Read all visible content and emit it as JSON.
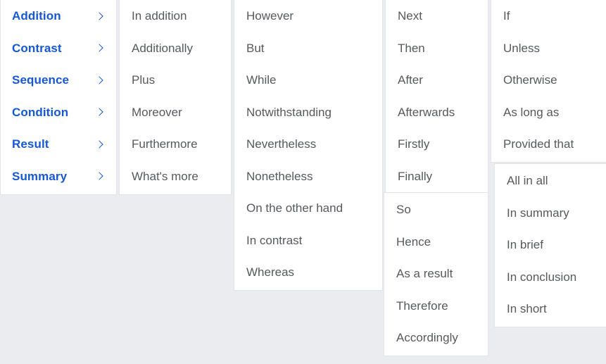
{
  "theme": {
    "background": "#ebecef",
    "panel_background": "#ffffff",
    "panel_border": "#e3e4e8",
    "accent_blue": "#1558d6",
    "leaf_text": "#56595d"
  },
  "menu": {
    "categories": {
      "panel_name": "categories-panel",
      "chevron_glyph": "chevron-right-icon",
      "items": [
        {
          "label": "Addition"
        },
        {
          "label": "Contrast"
        },
        {
          "label": "Sequence"
        },
        {
          "label": "Condition"
        },
        {
          "label": "Result"
        },
        {
          "label": "Summary"
        }
      ]
    },
    "addition": {
      "panel_name": "addition-panel",
      "items": [
        {
          "label": "In addition"
        },
        {
          "label": "Additionally"
        },
        {
          "label": "Plus"
        },
        {
          "label": "Moreover"
        },
        {
          "label": "Furthermore"
        },
        {
          "label": "What's more"
        }
      ]
    },
    "contrast": {
      "panel_name": "contrast-panel",
      "items": [
        {
          "label": "However"
        },
        {
          "label": "But"
        },
        {
          "label": "While"
        },
        {
          "label": "Notwithstanding"
        },
        {
          "label": "Nevertheless"
        },
        {
          "label": "Nonetheless"
        },
        {
          "label": "On the other hand"
        },
        {
          "label": "In contrast"
        },
        {
          "label": "Whereas"
        }
      ]
    },
    "sequence": {
      "panel_name": "sequence-panel",
      "items": [
        {
          "label": "Next"
        },
        {
          "label": "Then"
        },
        {
          "label": "After"
        },
        {
          "label": "Afterwards"
        },
        {
          "label": "Firstly"
        },
        {
          "label": "Finally"
        }
      ]
    },
    "result": {
      "panel_name": "result-panel",
      "items": [
        {
          "label": "So"
        },
        {
          "label": "Hence"
        },
        {
          "label": "As a result"
        },
        {
          "label": "Therefore"
        },
        {
          "label": "Accordingly"
        }
      ]
    },
    "condition": {
      "panel_name": "condition-panel",
      "items": [
        {
          "label": "If"
        },
        {
          "label": "Unless"
        },
        {
          "label": "Otherwise"
        },
        {
          "label": "As long as"
        },
        {
          "label": "Provided that"
        }
      ]
    },
    "summary": {
      "panel_name": "summary-panel",
      "items": [
        {
          "label": "All in all"
        },
        {
          "label": "In summary"
        },
        {
          "label": "In brief"
        },
        {
          "label": "In conclusion"
        },
        {
          "label": "In short"
        }
      ]
    }
  }
}
